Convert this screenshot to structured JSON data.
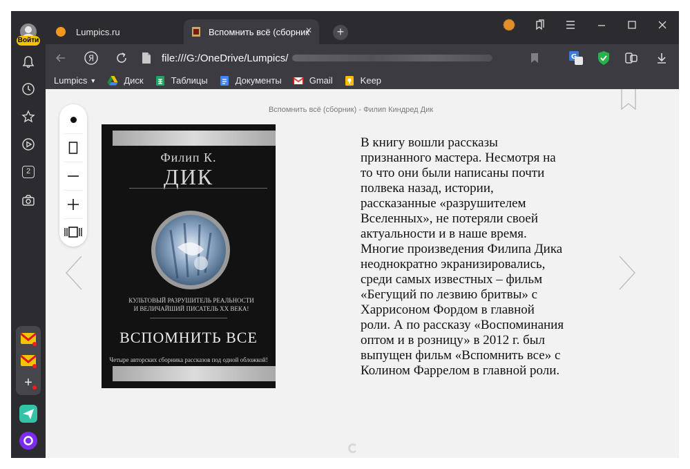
{
  "sidebar": {
    "login_label": "Войти",
    "group_add_label": "+",
    "tab_count": "2"
  },
  "tabs": [
    {
      "title": "Lumpics.ru"
    },
    {
      "title": "Вспомнить всё (сборник"
    }
  ],
  "new_tab_label": "+",
  "address": {
    "url": "file:///G:/OneDrive/Lumpics/"
  },
  "bookmarks": [
    {
      "label": "Lumpics",
      "has_dropdown": true
    },
    {
      "label": "Диск"
    },
    {
      "label": "Таблицы"
    },
    {
      "label": "Документы"
    },
    {
      "label": "Gmail"
    },
    {
      "label": "Keep"
    }
  ],
  "reader": {
    "heading": "Вспомнить всё (сборник) - Филип Киндред Дик",
    "cover": {
      "author_first": "Филип К.",
      "author_last": "ДИК",
      "tagline_1": "КУЛЬТОВЫЙ РАЗРУШИТЕЛЬ РЕАЛЬНОСТИ",
      "tagline_2": "И ВЕЛИЧАЙШИЙ ПИСАТЕЛЬ XX ВЕКА!",
      "title": "ВСПОМНИТЬ ВСЕ",
      "note": "Четыре авторских сборника рассказов под одной обложкой!"
    },
    "description_lines": [
      "В книгу вошли рассказы",
      "признанного мастера. Несмотря на",
      "то что они были написаны почти",
      "полвека назад, истории,",
      "рассказанные «разрушителем",
      "Вселенных», не потеряли своей",
      "актуальности и в наше время.",
      "Многие произведения Филипа Дика",
      "неоднократно экранизировались,",
      "среди самых известных – фильм",
      "«Бегущий по лезвию бритвы» с",
      "Харрисоном Фордом в главной",
      "роли. А по рассказу «Воспоминания",
      "оптом и в розницу» в 2012 г. был",
      "выпущен фильм «Вспомнить все» с",
      "Колином Фаррелом в главной роли."
    ]
  },
  "colors": {
    "chrome_dark": "#2b2b30",
    "toolbar": "#3b3b41",
    "page_bg": "#f2f2f2",
    "login_badge": "#f5c400"
  }
}
